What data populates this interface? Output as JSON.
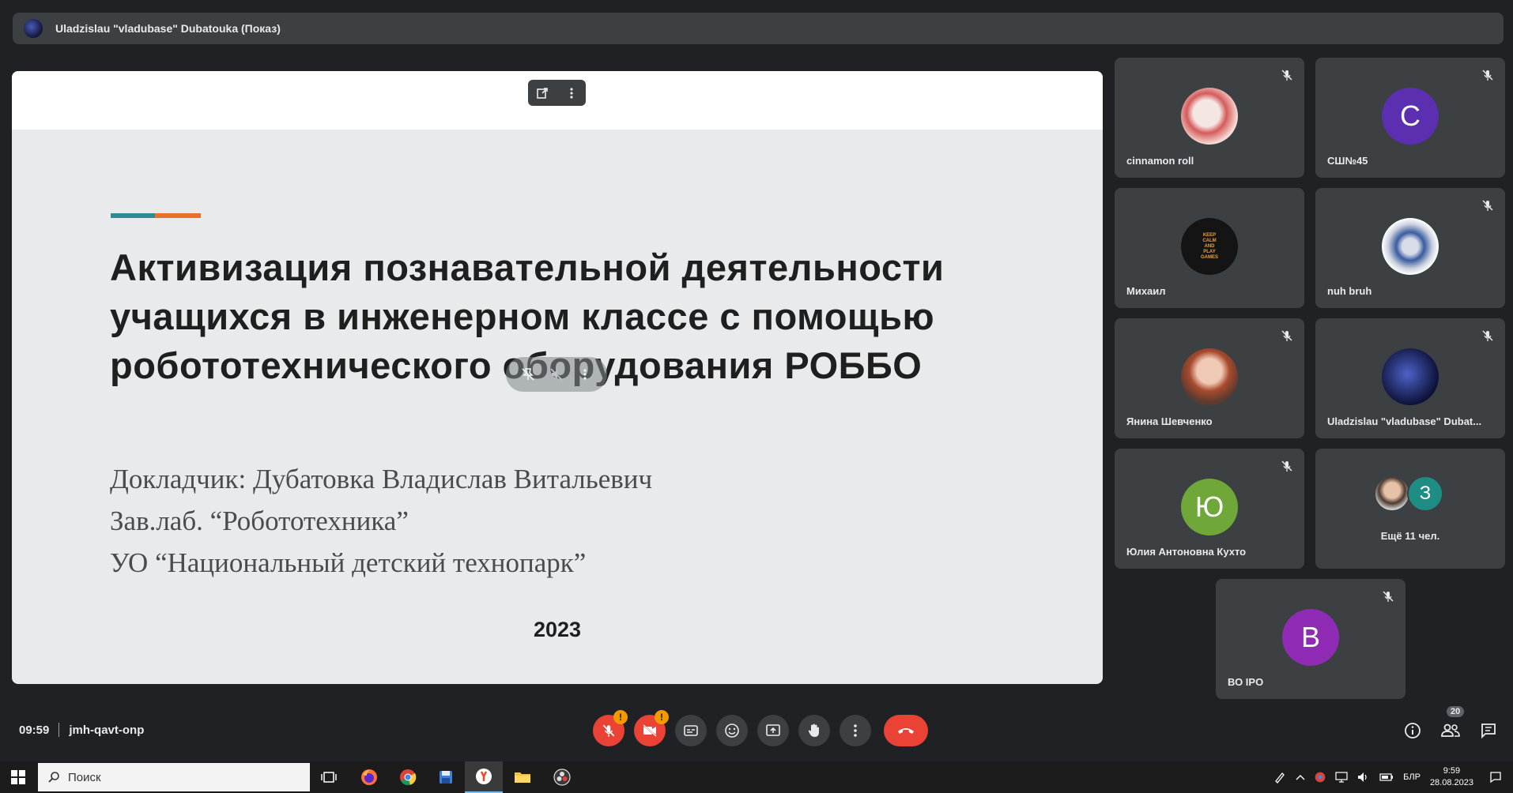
{
  "presenter": {
    "name": "Uladzislau \"vladubase\" Dubatouka (Показ)"
  },
  "slide": {
    "title_lines": [
      "Активизация познавательной деятельности",
      "учащихся в инженерном классе с помощью",
      "робототехнического оборудования РОББО"
    ],
    "speaker_lines": [
      "Докладчик: Дубатовка Владислав Витальевич",
      "Зав.лаб. “Робототехника”",
      "УО “Национальный детский технопарк”"
    ],
    "year": "2023",
    "accent_colors": [
      "#2f8a93",
      "#e8712a"
    ]
  },
  "participants": [
    {
      "name": "cinnamon roll",
      "avatar": "photo",
      "muted": true
    },
    {
      "name": "СШ№45",
      "initial": "С",
      "color": "#5b2fb0",
      "muted": true
    },
    {
      "name": "Михаил",
      "avatar": "keep-calm-image",
      "avatar_text": [
        "KEEP",
        "CALM",
        "AND",
        "PLAY",
        "GAMES"
      ],
      "muted": false
    },
    {
      "name": "nuh bruh",
      "avatar": "photo",
      "muted": true
    },
    {
      "name": "Янина Шевченко",
      "avatar": "photo",
      "muted": true
    },
    {
      "name": "Uladzislau \"vladubase\" Dubat...",
      "avatar": "photo",
      "muted": true
    },
    {
      "name": "Юлия Антоновна Кухто",
      "initial": "Ю",
      "color": "#6fa838",
      "muted": true
    },
    {
      "name": "Ещё 11 чел.",
      "initial": "З",
      "color": "#1e8e85",
      "muted": false
    },
    {
      "name": "ВО IPO",
      "initial": "В",
      "color": "#8f2bb5",
      "muted": true
    }
  ],
  "meeting": {
    "time": "09:59",
    "code": "jmh-qavt-onp",
    "people_count": "20"
  },
  "taskbar": {
    "search_placeholder": "Поиск",
    "language": "БЛР",
    "clock_time": "9:59",
    "clock_date": "28.08.2023"
  },
  "colors": {
    "background": "#202124",
    "tile": "#3c4043",
    "end_call": "#ea4335",
    "warning": "#f29900"
  }
}
